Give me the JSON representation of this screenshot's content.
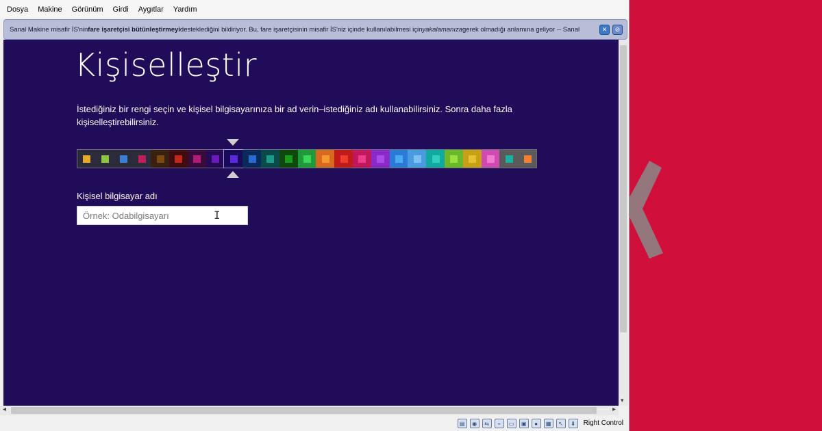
{
  "menubar": {
    "items": [
      "Dosya",
      "Makine",
      "Görünüm",
      "Girdi",
      "Aygıtlar",
      "Yardım"
    ]
  },
  "notification": {
    "text_1": "Sanal Makine misafir İS'nin ",
    "bold": "fare işaretçisi bütünleştirmeyi",
    "text_2": " desteklediğini bildiriyor. Bu, fare işaretçisinin misafir İS'niz içinde kullanılabilmesi için ",
    "italic": "yakalamanıza",
    "text_3": " gerek olmadığı anlamına geliyor -- Sanal"
  },
  "guest": {
    "background": "#210c5a",
    "title": "Kişiselleştir",
    "description": "İstediğiniz bir rengi seçin ve kişisel bilgisayarınıza bir ad verin–istediğiniz adı kullanabilirsiniz. Sonra daha fazla kişiselleştirebilirsiniz.",
    "color_picker": {
      "selected_index": 8,
      "swatches": [
        {
          "bg": "#2b2b3c",
          "chip": "#e6a92a"
        },
        {
          "bg": "#2b2b3c",
          "chip": "#8cc63f"
        },
        {
          "bg": "#2b2b3c",
          "chip": "#3a7fd5"
        },
        {
          "bg": "#2b2b3c",
          "chip": "#c01e5a"
        },
        {
          "bg": "#3a2010",
          "chip": "#7a4a10"
        },
        {
          "bg": "#3e0d10",
          "chip": "#c0281c"
        },
        {
          "bg": "#3a0a3a",
          "chip": "#b01c78"
        },
        {
          "bg": "#250a55",
          "chip": "#6a1ab8"
        },
        {
          "bg": "#1a0a5a",
          "chip": "#5a2ad8"
        },
        {
          "bg": "#0a2a5a",
          "chip": "#2a6ad0"
        },
        {
          "bg": "#0a4a4a",
          "chip": "#1a9a8a"
        },
        {
          "bg": "#0e4a0e",
          "chip": "#1a9a1a"
        },
        {
          "bg": "#1f9a3a",
          "chip": "#3ad65a"
        },
        {
          "bg": "#d86a20",
          "chip": "#f59a30"
        },
        {
          "bg": "#c01a1a",
          "chip": "#f03a2a"
        },
        {
          "bg": "#c0185a",
          "chip": "#f03a8a"
        },
        {
          "bg": "#8a2ac8",
          "chip": "#aa4ae8"
        },
        {
          "bg": "#2a7ad8",
          "chip": "#4aaaf0"
        },
        {
          "bg": "#4a9ae0",
          "chip": "#7ac0f5"
        },
        {
          "bg": "#10a8a0",
          "chip": "#30d0c0"
        },
        {
          "bg": "#6ab82a",
          "chip": "#9ae040"
        },
        {
          "bg": "#c8a018",
          "chip": "#e8c030"
        },
        {
          "bg": "#d04ab0",
          "chip": "#f07ad0"
        },
        {
          "bg": "#5a5a5a",
          "chip": "#1ab0a0"
        },
        {
          "bg": "#5a5a5a",
          "chip": "#f08030"
        }
      ]
    },
    "pc_name_label": "Kişisel bilgisayar adı",
    "pc_name_placeholder": "Örnek: Odabilgisayarı",
    "pc_name_value": ""
  },
  "statusbar": {
    "icons": [
      "hard-disk-icon",
      "optical-drive-icon",
      "network-icon",
      "usb-icon",
      "shared-folders-icon",
      "display-icon",
      "video-capture-icon",
      "cpu-icon",
      "mouse-integration-icon",
      "keyboard-capture-icon"
    ],
    "host_key_label": "Right Control"
  },
  "desktop": {
    "background": "#d0103a"
  }
}
